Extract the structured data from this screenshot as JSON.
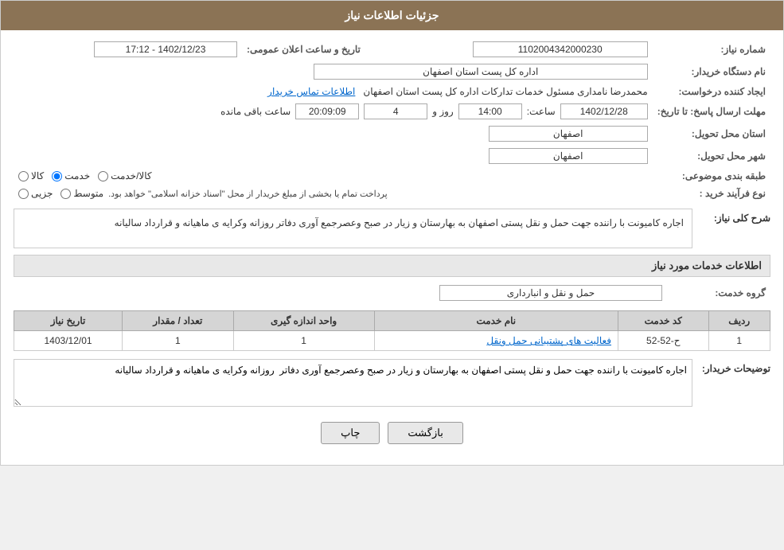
{
  "header": {
    "title": "جزئیات اطلاعات نیاز"
  },
  "fields": {
    "need_number_label": "شماره نیاز:",
    "need_number_value": "1102004342000230",
    "buyer_org_label": "نام دستگاه خریدار:",
    "buyer_org_value": "اداره کل پست استان اصفهان",
    "announcement_date_label": "تاریخ و ساعت اعلان عمومی:",
    "announcement_date_value": "1402/12/23 - 17:12",
    "creator_label": "ایجاد کننده درخواست:",
    "creator_value": "محمدرضا نامداری مسئول خدمات تدارکات اداره کل پست استان اصفهان",
    "contact_info_link": "اطلاعات تماس خریدار",
    "deadline_label": "مهلت ارسال پاسخ: تا تاریخ:",
    "deadline_date": "1402/12/28",
    "deadline_time_label": "ساعت:",
    "deadline_time": "14:00",
    "deadline_day_label": "روز و",
    "deadline_days": "4",
    "deadline_remaining_label": "ساعت باقی مانده",
    "deadline_remaining": "20:09:09",
    "province_label": "استان محل تحویل:",
    "province_value": "اصفهان",
    "city_label": "شهر محل تحویل:",
    "city_value": "اصفهان",
    "category_label": "طبقه بندی موضوعی:",
    "category_option1": "کالا",
    "category_option2": "خدمت",
    "category_option3": "کالا/خدمت",
    "category_selected": "خدمت",
    "purchase_type_label": "نوع فرآیند خرید :",
    "purchase_option1": "جزیی",
    "purchase_option2": "متوسط",
    "purchase_note": "پرداخت تمام یا بخشی از مبلغ خریدار از محل \"اسناد خزانه اسلامی\" خواهد بود."
  },
  "description": {
    "section_title": "شرح کلی نیاز:",
    "content": "اجاره کامیونت با راننده جهت حمل و نقل پستی اصفهان به بهارستان و زیار در صبح وعصرجمع آوری دفاتر  روزانه وکرایه ی ماهیانه و قرارداد سالیانه"
  },
  "services_section": {
    "title": "اطلاعات خدمات مورد نیاز",
    "group_label": "گروه خدمت:",
    "group_value": "حمل و نقل و انبارداری"
  },
  "table": {
    "headers": [
      "ردیف",
      "کد خدمت",
      "نام خدمت",
      "واحد اندازه گیری",
      "تعداد / مقدار",
      "تاریخ نیاز"
    ],
    "rows": [
      {
        "row": "1",
        "code": "ح-52-52",
        "name": "فعالیت های پشتیبانی حمل ونقل",
        "unit": "1",
        "quantity": "1",
        "date": "1403/12/01"
      }
    ]
  },
  "buyer_description": {
    "label": "توضیحات خریدار:",
    "content": "اجاره کامیونت با راننده جهت حمل و نقل پستی اصفهان به بهارستان و زیار در صبح وعصرجمع آوری دفاتر  روزانه وکرایه ی ماهیانه و قرارداد سالیانه"
  },
  "buttons": {
    "print": "چاپ",
    "back": "بازگشت"
  }
}
